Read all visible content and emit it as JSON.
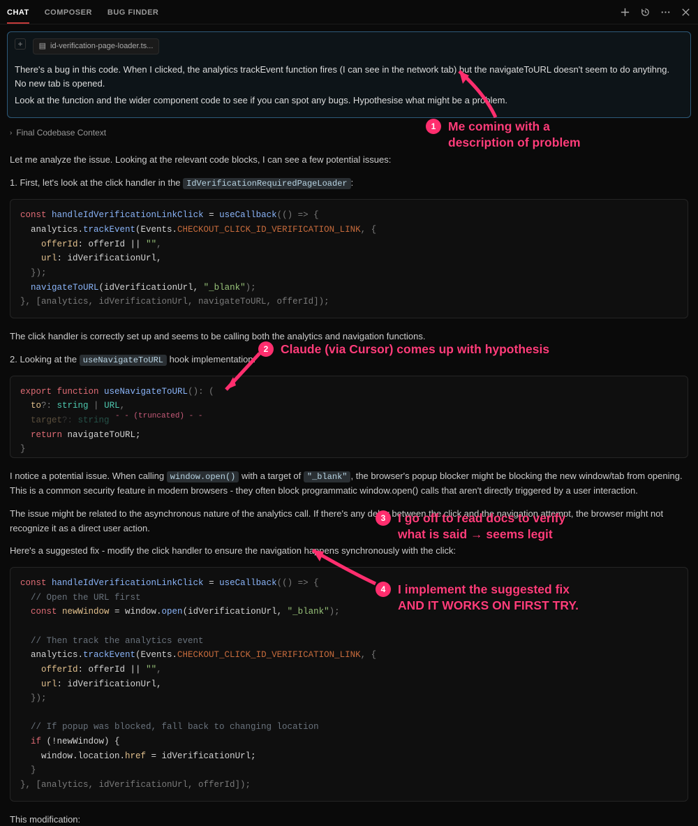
{
  "topbar": {
    "tabs": {
      "chat": "CHAT",
      "composer": "COMPOSER",
      "bugfinder": "BUG FINDER"
    }
  },
  "user_message": {
    "file_chip": "id-verification-page-loader.ts...",
    "p1": "There's a bug in this code. When I clicked, the analytics trackEvent function fires (I can see in the network tab) but the navigateToURL doesn't seem to do anytihng. No new tab is opened.",
    "p2": "Look at the function and the wider component code to see if you can spot any bugs. Hypothesise what might be a problem."
  },
  "collapse_label": "Final Codebase Context",
  "assist": {
    "p1": "Let me analyze the issue. Looking at the relevant code blocks, I can see a few potential issues:",
    "p2_a": "1. First, let's look at the click handler in the ",
    "p2_code": "IdVerificationRequiredPageLoader",
    "p2_b": ":",
    "p3": "The click handler is correctly set up and seems to be calling both the analytics and navigation functions.",
    "p4_a": "2. Looking at the ",
    "p4_code": "useNavigateToURL",
    "p4_b": " hook implementation:",
    "trunc": "- - (truncated) - -",
    "p5_a": "I notice a potential issue. When calling ",
    "p5_code1": "window.open()",
    "p5_b": " with a target of ",
    "p5_code2": "\"_blank\"",
    "p5_c": ", the browser's popup blocker might be blocking the new window/tab from opening. This is a common security feature in modern browsers - they often block programmatic window.open() calls that aren't directly triggered by a user interaction.",
    "p6": "The issue might be related to the asynchronous nature of the analytics call. If there's any delay between the click and the navigation attempt, the browser might not recognize it as a direct user action.",
    "p7": "Here's a suggested fix - modify the click handler to ensure the navigation happens synchronously with the click:",
    "p8": "This modification:"
  },
  "code1": {
    "l1a": "const",
    "l1b": "handleIdVerificationLinkClick",
    "l1c": " = ",
    "l1d": "useCallback",
    "l1e": "(() => {",
    "l2a": "  analytics.",
    "l2b": "trackEvent",
    "l2c": "(Events.",
    "l2d": "CHECKOUT_CLICK_ID_VERIFICATION_LINK",
    "l2e": ", {",
    "l3a": "    ",
    "l3b": "offerId",
    "l3c": ": offerId || ",
    "l3d": "\"\"",
    "l3e": ",",
    "l4a": "    ",
    "l4b": "url",
    "l4c": ": idVerificationUrl,",
    "l5": "  });",
    "l6a": "  ",
    "l6b": "navigateToURL",
    "l6c": "(idVerificationUrl, ",
    "l6d": "\"_blank\"",
    "l6e": ");",
    "l7a": "}, [analytics, idVerificationUrl, navigateToURL, offerId]);"
  },
  "code2": {
    "l1a": "export",
    "l1b": " function",
    "l1c": " useNavigateToURL",
    "l1d": "(): (",
    "l2a": "  to",
    "l2b": "?: ",
    "l2c": "string",
    "l2d": " | ",
    "l2e": "URL",
    "l2f": ",",
    "l3a": "  target",
    "l3b": "?: ",
    "l3c": "string",
    "l4a": "  return",
    "l4b": " navigateToURL;",
    "l5": "}"
  },
  "code3": {
    "l1a": "const",
    "l1b": " handleIdVerificationLinkClick",
    "l1c": " = ",
    "l1d": "useCallback",
    "l1e": "(() => {",
    "l2": "  // Open the URL first",
    "l3a": "  const",
    "l3b": " newWindow",
    "l3c": " = window.",
    "l3d": "open",
    "l3e": "(idVerificationUrl, ",
    "l3f": "\"_blank\"",
    "l3g": ");",
    "l4": "",
    "l5": "  // Then track the analytics event",
    "l6a": "  analytics.",
    "l6b": "trackEvent",
    "l6c": "(Events.",
    "l6d": "CHECKOUT_CLICK_ID_VERIFICATION_LINK",
    "l6e": ", {",
    "l7a": "    ",
    "l7b": "offerId",
    "l7c": ": offerId || ",
    "l7d": "\"\"",
    "l7e": ",",
    "l8a": "    ",
    "l8b": "url",
    "l8c": ": idVerificationUrl,",
    "l9": "  });",
    "l10": "",
    "l11": "  // If popup was blocked, fall back to changing location",
    "l12a": "  if",
    "l12b": " (!newWindow) {",
    "l13a": "    window.location.",
    "l13b": "href",
    "l13c": " = idVerificationUrl;",
    "l14": "  }",
    "l15": "}, [analytics, idVerificationUrl, offerId]);"
  },
  "annotations": {
    "a1_num": "1",
    "a1_text": "Me coming with a\ndescription of problem",
    "a2_num": "2",
    "a2_text": "Claude (via Cursor) comes up with hypothesis",
    "a3_num": "3",
    "a3_text": "I go off to read docs to verify\nwhat is said → seems legit",
    "a4_num": "4",
    "a4_text": "I implement the suggested fix\nAND IT WORKS ON FIRST TRY."
  }
}
